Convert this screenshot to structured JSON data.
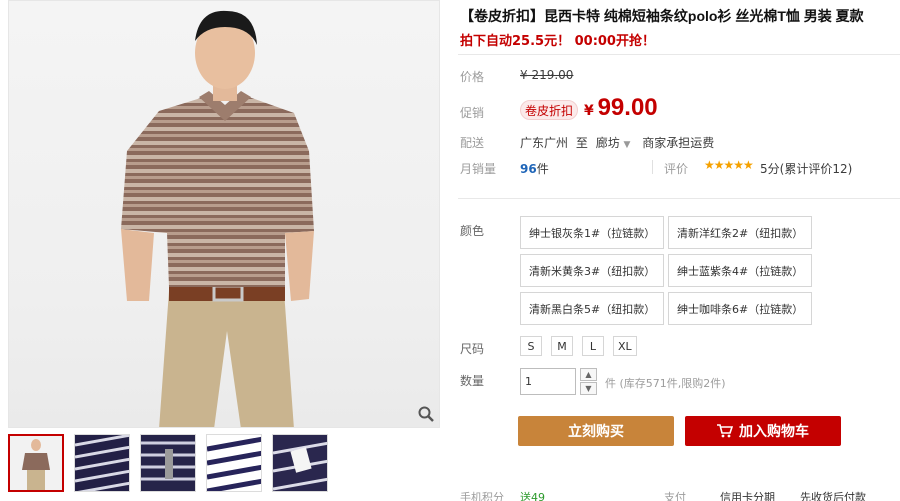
{
  "product": {
    "title": "【卷皮折扣】昆西卡特 纯棉短袖条纹polo衫 丝光棉T恤 男装 夏款",
    "subtitle": "拍下自动25.5元！ 00:00开抢！"
  },
  "price": {
    "original_label": "价格",
    "original_value": "¥ 219.00",
    "promo_label": "促销",
    "promo_badge": "卷皮折扣",
    "currency": "¥",
    "sale_value": "99.00"
  },
  "shipping": {
    "label": "配送",
    "from": "广东广州",
    "to_word": "至",
    "destination": "廊坊",
    "fee_note": "商家承担运费"
  },
  "sales": {
    "label": "月销量",
    "count": "96",
    "unit": "件",
    "review_label": "评价",
    "stars": "★★★★★",
    "rating_text": "5分(累计评价12)"
  },
  "color": {
    "label": "颜色",
    "options": [
      "绅士银灰条1#（拉链款）",
      "清新洋红条2#（纽扣款）",
      "清新米黄条3#（纽扣款）",
      "绅士蓝紫条4#（拉链款）",
      "清新黑白条5#（纽扣款）",
      "绅士咖啡条6#（拉链款）"
    ]
  },
  "size": {
    "label": "尺码",
    "options": [
      "S",
      "M",
      "L",
      "XL"
    ]
  },
  "quantity": {
    "label": "数量",
    "value": "1",
    "stock_note": "件 (库存571件,限购2件)"
  },
  "actions": {
    "buy_now": "立刻购买",
    "add_to_cart": "加入购物车"
  },
  "bottom": {
    "points_label": "手机积分",
    "points_value": "送49",
    "pay_label": "支付",
    "credit": "信用卡分期",
    "later": "先收货后付款"
  },
  "colors": {
    "accent_red": "#c40000",
    "buy_orange": "#c8843a",
    "link_blue": "#1f65b8",
    "star_gold": "#f5a100"
  }
}
